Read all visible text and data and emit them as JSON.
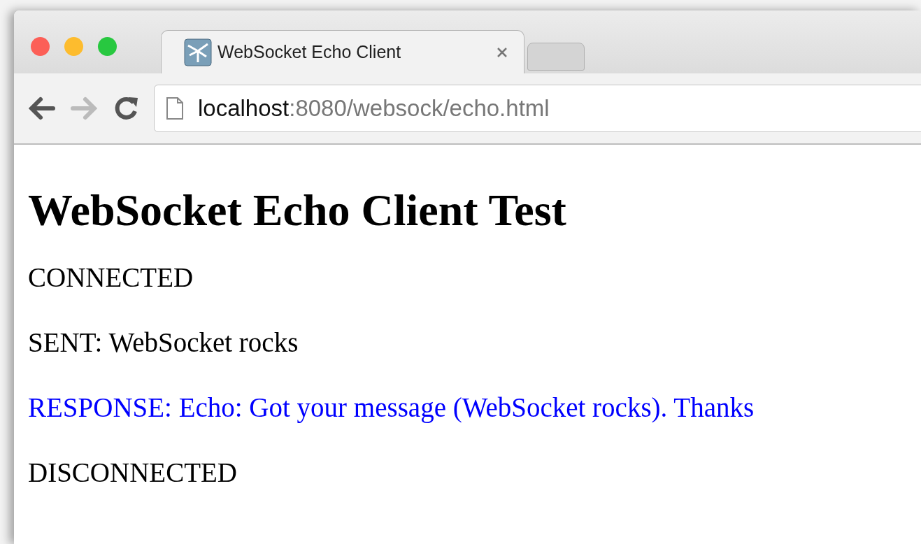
{
  "tabs": [
    {
      "title": "WebSocket Echo Client",
      "selected": true
    }
  ],
  "toolbar": {
    "back_disabled": false,
    "forward_disabled": true,
    "address_host": "localhost",
    "address_path": ":8080/websock/echo.html"
  },
  "page": {
    "heading": "WebSocket Echo Client Test",
    "messages": [
      {
        "kind": "status",
        "text": "CONNECTED"
      },
      {
        "kind": "sent",
        "text": "SENT: WebSocket rocks"
      },
      {
        "kind": "response",
        "text": "RESPONSE: Echo: Got your message (WebSocket rocks). Thanks"
      },
      {
        "kind": "status",
        "text": "DISCONNECTED"
      }
    ]
  }
}
